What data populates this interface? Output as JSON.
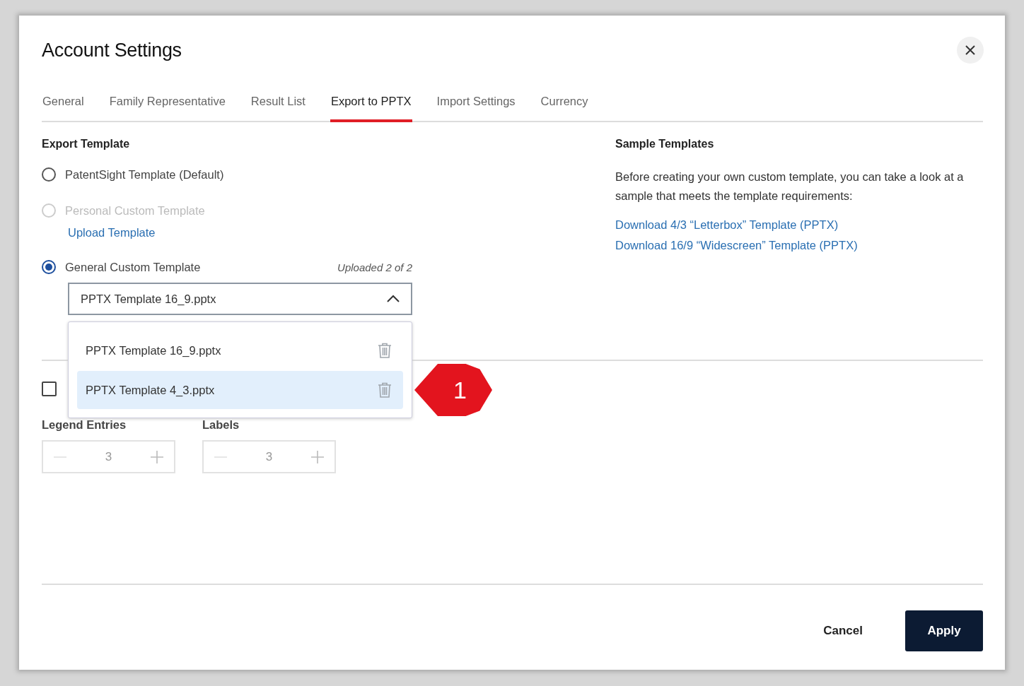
{
  "dialog": {
    "title": "Account Settings"
  },
  "tabs": [
    {
      "label": "General",
      "selected": false
    },
    {
      "label": "Family Representative",
      "selected": false
    },
    {
      "label": "Result List",
      "selected": false
    },
    {
      "label": "Export to PPTX",
      "selected": true
    },
    {
      "label": "Import Settings",
      "selected": false
    },
    {
      "label": "Currency",
      "selected": false
    }
  ],
  "export_template": {
    "heading": "Export Template",
    "options": [
      {
        "label": "PatentSight Template (Default)",
        "selected": false,
        "disabled": false
      },
      {
        "label": "Personal Custom Template",
        "selected": false,
        "disabled": true,
        "link": "Upload Template"
      },
      {
        "label": "General Custom Template",
        "selected": true,
        "disabled": false,
        "note": "Uploaded 2 of 2",
        "dropdown": {
          "value": "PPTX Template 16_9.pptx",
          "expanded": true,
          "items": [
            {
              "label": "PPTX Template 16_9.pptx",
              "highlighted": false
            },
            {
              "label": "PPTX Template 4_3.pptx",
              "highlighted": true
            }
          ]
        }
      }
    ]
  },
  "checkbox": {
    "checked": false
  },
  "steppers": [
    {
      "label": "Legend Entries",
      "value": "3"
    },
    {
      "label": "Labels",
      "value": "3"
    }
  ],
  "sample_templates": {
    "heading": "Sample Templates",
    "text": "Before creating your own custom template, you can take a look at a sample that meets the template requirements:",
    "links": [
      "Download 4/3 “Letterbox” Template (PPTX)",
      "Download 16/9 “Widescreen” Template (PPTX)"
    ]
  },
  "callout": {
    "number": "1"
  },
  "buttons": [
    {
      "label": "Cancel",
      "kind": "secondary"
    },
    {
      "label": "Apply",
      "kind": "primary"
    }
  ]
}
